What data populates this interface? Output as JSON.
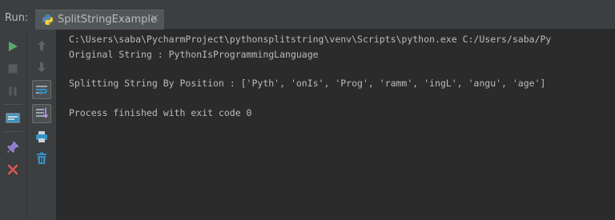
{
  "run_panel": {
    "label": "Run:",
    "tab": {
      "title": "SplitStringExample",
      "close_glyph": "×",
      "icon": "python-icon"
    }
  },
  "toolbar_left": [
    {
      "name": "rerun-icon",
      "color": "#59a869"
    },
    {
      "name": "stop-icon",
      "color": "#6b6b6b"
    },
    {
      "name": "pause-icon",
      "color": "#6b6b6b"
    },
    {
      "name": "dump-threads-icon",
      "color": "#9aa7b0"
    },
    {
      "name": "pin-tab-icon",
      "color": "#b99bf8"
    },
    {
      "name": "close-icon",
      "color": "#e05555"
    }
  ],
  "toolbar_right": [
    {
      "name": "up-arrow-icon"
    },
    {
      "name": "down-arrow-icon"
    },
    {
      "name": "soft-wrap-icon"
    },
    {
      "name": "scroll-to-end-icon"
    },
    {
      "name": "print-icon"
    },
    {
      "name": "clear-all-icon"
    }
  ],
  "console": {
    "lines": [
      "C:\\Users\\saba\\PycharmProject\\pythonsplitstring\\venv\\Scripts\\python.exe C:/Users/saba/Py",
      "Original String : PythonIsProgrammingLanguage",
      "",
      "Splitting String By Position : ['Pyth', 'onIs', 'Prog', 'ramm', 'ingL', 'angu', 'age']",
      "",
      "Process finished with exit code 0"
    ]
  },
  "colors": {
    "background": "#2b2b2b",
    "panel": "#3c3f41",
    "text": "#bbbbbb"
  }
}
